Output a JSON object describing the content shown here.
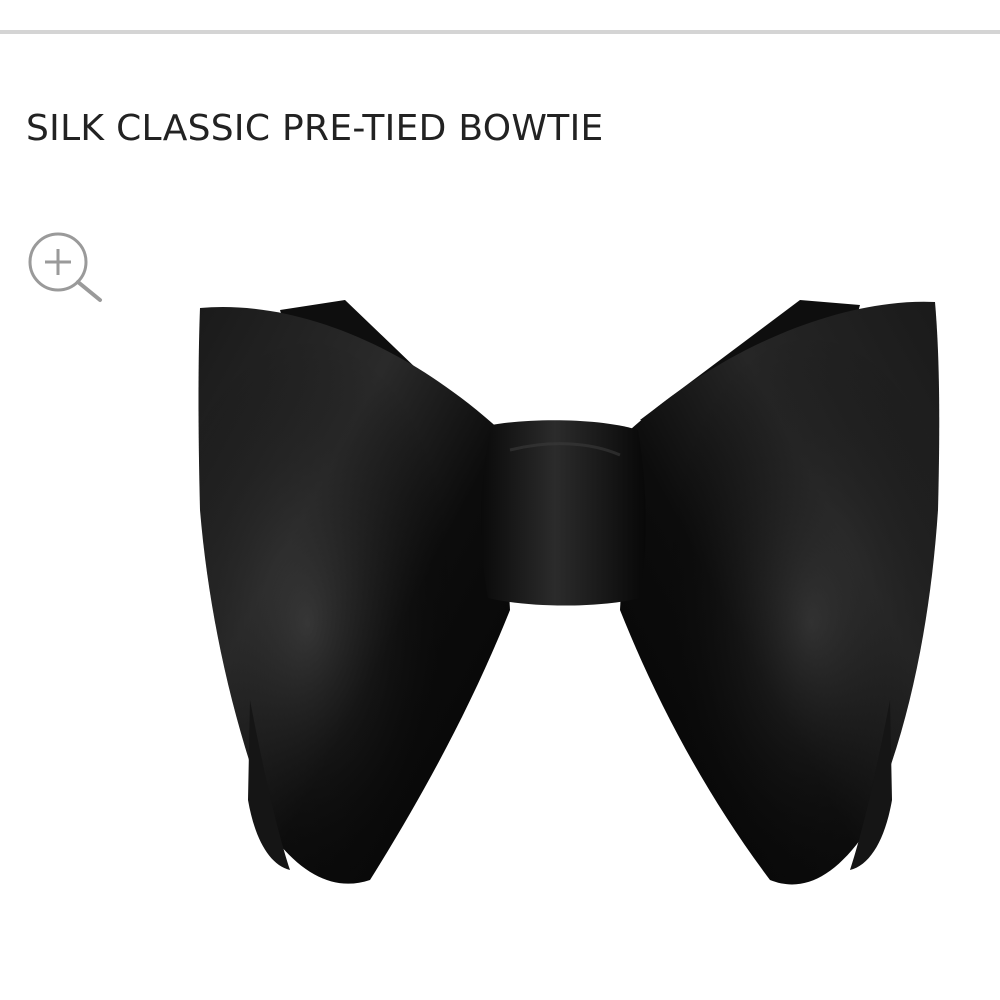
{
  "product": {
    "title": "SILK CLASSIC PRE-TIED BOWTIE",
    "image": {
      "subject": "black silk satin pre-tied bowtie",
      "colors": {
        "silk_dark": "#0b0b0b",
        "silk_mid": "#1c1c1c",
        "silk_sheen": "#5a5a5a"
      }
    }
  },
  "controls": {
    "zoom_icon": "zoom-in-icon"
  },
  "theme": {
    "background": "#ffffff",
    "rule_color": "#d4d4d4",
    "text_color": "#222222",
    "icon_color": "#9a9a9a"
  }
}
